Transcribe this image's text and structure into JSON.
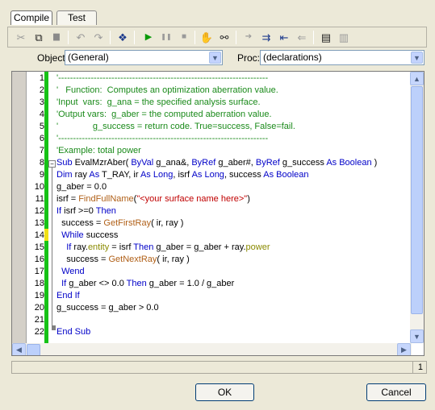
{
  "tabs": [
    {
      "label": "Compile",
      "active": true
    },
    {
      "label": "Test",
      "active": false
    }
  ],
  "toolbar": {
    "buttons": [
      {
        "name": "cut-icon",
        "glyph": "✂",
        "enabled": false
      },
      {
        "name": "copy-icon",
        "glyph": "⧉",
        "enabled": true
      },
      {
        "name": "paste-icon",
        "glyph": "▆",
        "enabled": false
      },
      {
        "name": "undo-icon",
        "glyph": "↶",
        "enabled": false
      },
      {
        "name": "redo-icon",
        "glyph": "↷",
        "enabled": false
      },
      {
        "name": "object-browser-icon",
        "glyph": "❖",
        "enabled": true
      },
      {
        "name": "run-icon",
        "glyph": "▶",
        "enabled": true
      },
      {
        "name": "pause-icon",
        "glyph": "❚❚",
        "enabled": false
      },
      {
        "name": "stop-icon",
        "glyph": "■",
        "enabled": false
      },
      {
        "name": "toggle-breakpoint-icon",
        "glyph": "✋",
        "enabled": true
      },
      {
        "name": "quick-watch-icon",
        "glyph": "⚯",
        "enabled": true
      },
      {
        "name": "step-into-icon",
        "glyph": "➔",
        "enabled": false
      },
      {
        "name": "step-over-icon",
        "glyph": "⇉",
        "enabled": true
      },
      {
        "name": "step-out-icon",
        "glyph": "⇤",
        "enabled": true
      },
      {
        "name": "call-stack-icon",
        "glyph": "⇐",
        "enabled": false
      },
      {
        "name": "user-dialog-icon",
        "glyph": "▤",
        "enabled": true
      },
      {
        "name": "references-icon",
        "glyph": "▥",
        "enabled": false
      }
    ]
  },
  "object": {
    "label": "Object:",
    "value": "(General)"
  },
  "proc": {
    "label": "Proc:",
    "value": "(declarations)"
  },
  "code_lines": [
    [
      {
        "t": "'-----------------------------------------------------------------------",
        "c": "cm"
      }
    ],
    [
      {
        "t": "'   Function:  Computes an optimization aberration value.",
        "c": "cm"
      }
    ],
    [
      {
        "t": "'Input  vars:  g_ana = the specified analysis surface.",
        "c": "cm"
      }
    ],
    [
      {
        "t": "'Output vars:  g_aber = the computed aberration value.",
        "c": "cm"
      }
    ],
    [
      {
        "t": "'              g_success = return code. True=success, False=fail.",
        "c": "cm"
      }
    ],
    [
      {
        "t": "'-----------------------------------------------------------------------",
        "c": "cm"
      }
    ],
    [
      {
        "t": "'Example: total power",
        "c": "cm"
      }
    ],
    [
      {
        "t": "Sub ",
        "c": "kw"
      },
      {
        "t": "EvalMzrAber( ",
        "c": ""
      },
      {
        "t": "ByVal",
        "c": "kw"
      },
      {
        "t": " g_ana&, ",
        "c": ""
      },
      {
        "t": "ByRef",
        "c": "kw"
      },
      {
        "t": " g_aber#, ",
        "c": ""
      },
      {
        "t": "ByRef",
        "c": "kw"
      },
      {
        "t": " g_success ",
        "c": ""
      },
      {
        "t": "As Boolean",
        "c": "kw"
      },
      {
        "t": " )",
        "c": ""
      }
    ],
    [
      {
        "t": "Dim",
        "c": "kw"
      },
      {
        "t": " ray ",
        "c": ""
      },
      {
        "t": "As",
        "c": "kw"
      },
      {
        "t": " T_RAY, ir ",
        "c": ""
      },
      {
        "t": "As Long",
        "c": "kw"
      },
      {
        "t": ", isrf ",
        "c": ""
      },
      {
        "t": "As Long",
        "c": "kw"
      },
      {
        "t": ", success ",
        "c": ""
      },
      {
        "t": "As Boolean",
        "c": "kw"
      }
    ],
    [
      {
        "t": "g_aber = 0.0",
        "c": ""
      }
    ],
    [
      {
        "t": "isrf = ",
        "c": ""
      },
      {
        "t": "FindFullName",
        "c": "fn"
      },
      {
        "t": "(",
        "c": ""
      },
      {
        "t": "\"<your surface name here>\"",
        "c": "st"
      },
      {
        "t": ")",
        "c": ""
      }
    ],
    [
      {
        "t": "If",
        "c": "kw"
      },
      {
        "t": " isrf >=0 ",
        "c": ""
      },
      {
        "t": "Then",
        "c": "kw"
      }
    ],
    [
      {
        "t": "  success = ",
        "c": ""
      },
      {
        "t": "GetFirstRay",
        "c": "fn"
      },
      {
        "t": "( ir, ray )",
        "c": ""
      }
    ],
    [
      {
        "t": "  ",
        "c": ""
      },
      {
        "t": "While",
        "c": "kw"
      },
      {
        "t": " success",
        "c": ""
      }
    ],
    [
      {
        "t": "    ",
        "c": ""
      },
      {
        "t": "If",
        "c": "kw"
      },
      {
        "t": " ray.",
        "c": ""
      },
      {
        "t": "entity",
        "c": "pr"
      },
      {
        "t": " = isrf ",
        "c": ""
      },
      {
        "t": "Then",
        "c": "kw"
      },
      {
        "t": " g_aber = g_aber + ray.",
        "c": ""
      },
      {
        "t": "power",
        "c": "pr"
      }
    ],
    [
      {
        "t": "    success = ",
        "c": ""
      },
      {
        "t": "GetNextRay",
        "c": "fn"
      },
      {
        "t": "( ir, ray )",
        "c": ""
      }
    ],
    [
      {
        "t": "  ",
        "c": ""
      },
      {
        "t": "Wend",
        "c": "kw"
      }
    ],
    [
      {
        "t": "  ",
        "c": ""
      },
      {
        "t": "If",
        "c": "kw"
      },
      {
        "t": " g_aber <> 0.0 ",
        "c": ""
      },
      {
        "t": "Then",
        "c": "kw"
      },
      {
        "t": " g_aber = 1.0 / g_aber",
        "c": ""
      }
    ],
    [
      {
        "t": "End If",
        "c": "kw"
      }
    ],
    [
      {
        "t": "g_success = g_aber > 0.0",
        "c": ""
      }
    ],
    [
      {
        "t": "",
        "c": ""
      }
    ],
    [
      {
        "t": "End Sub",
        "c": "kw"
      }
    ]
  ],
  "status": {
    "line": "1"
  },
  "buttons": {
    "ok": "OK",
    "cancel": "Cancel"
  },
  "colors": {
    "keyword": "#0000c8",
    "comment": "#1a8a1a",
    "string": "#c00000",
    "function": "#b06018",
    "property": "#8a8a00",
    "changed_bar": "#16c216",
    "current_line_mark": "#f0e016"
  }
}
